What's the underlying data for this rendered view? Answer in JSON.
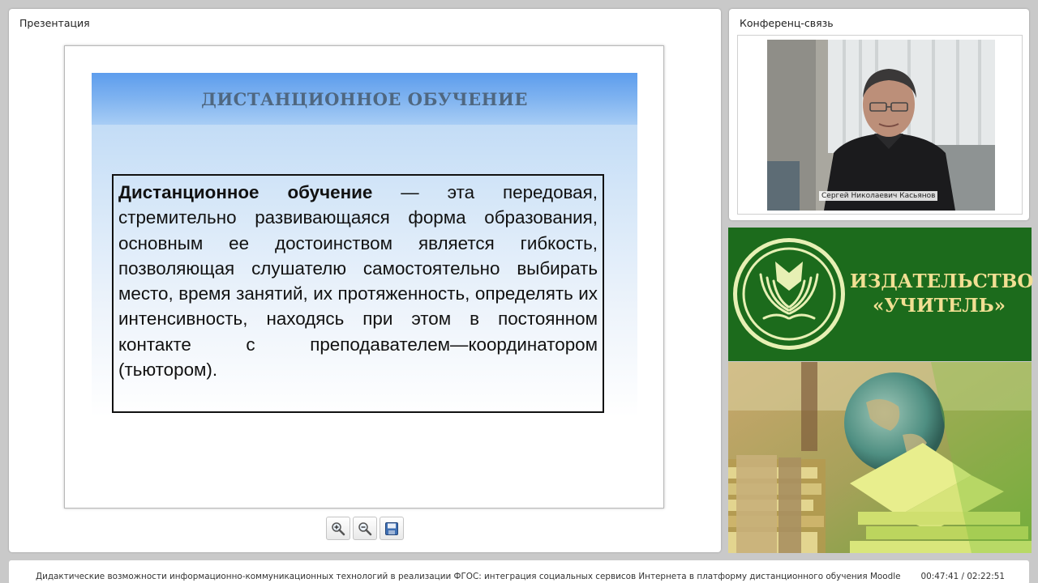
{
  "presentation": {
    "panel_title": "Презентация",
    "slide": {
      "title": "ДИСТАНЦИОННОЕ ОБУЧЕНИЕ",
      "term": "Дистанционное обучение",
      "definition": " — эта передовая, стремительно развивающаяся форма образования, основным ее достоинством является гибкость, позволяющая слушателю самостоятельно выбирать место, время занятий, их протяженность, определять их интенсивность, находясь при этом в постоянном контакте с преподавателем—координатором (тьютором)."
    },
    "toolbar": [
      {
        "name": "zoom-in",
        "icon": "zoom-in-icon"
      },
      {
        "name": "zoom-out",
        "icon": "zoom-out-icon"
      },
      {
        "name": "save",
        "icon": "save-icon"
      }
    ]
  },
  "conference": {
    "panel_title": "Конференц-связь",
    "speaker_name": "Сергей Николаевич Касьянов"
  },
  "publisher": {
    "line1": "ИЗДАТЕЛЬСТВО",
    "line2": "«УЧИТЕЛЬ»",
    "colors": {
      "background": "#1c6b1c",
      "text": "#f1df93"
    }
  },
  "footer": {
    "title": "Дидактические возможности информационно-коммуникационных технологий в реализации ФГОС: интеграция социальных сервисов Интернета в платформу дистанционного обучения Moodle",
    "time": "00:47:41 / 02:22:51"
  }
}
